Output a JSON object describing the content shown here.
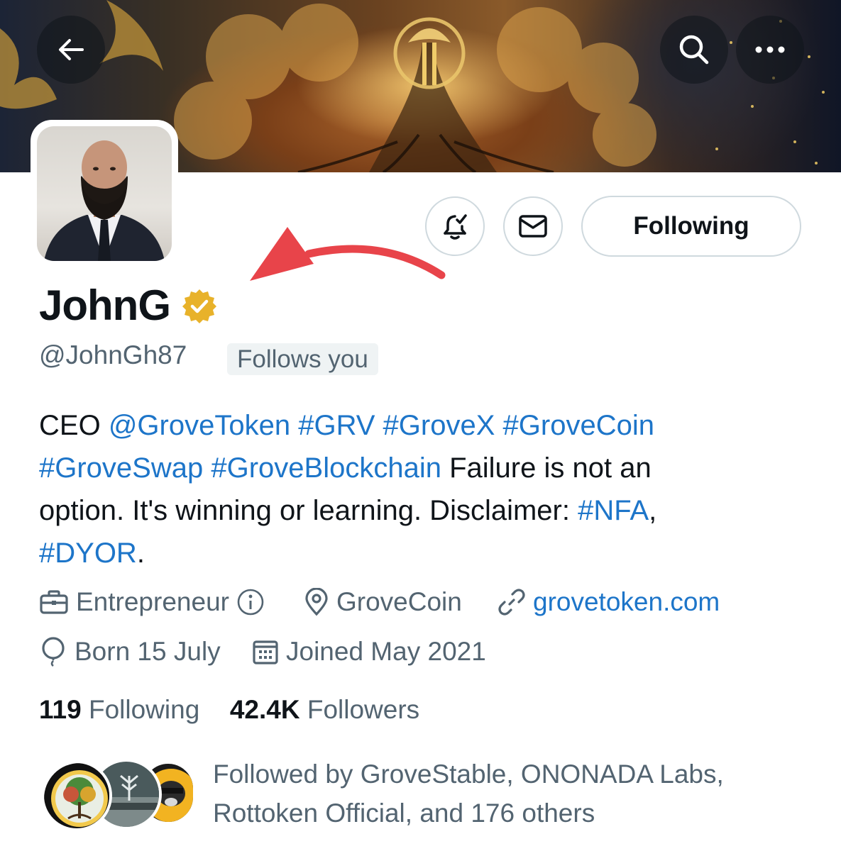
{
  "header": {
    "back_icon": "arrow-left-icon",
    "search_icon": "search-icon",
    "more_icon": "more-icon"
  },
  "actions": {
    "notify_icon": "bell-check-icon",
    "message_icon": "envelope-icon",
    "following_label": "Following"
  },
  "profile": {
    "display_name": "JohnG",
    "handle": "@JohnGh87",
    "follows_you": "Follows you",
    "verified_color": "#e8b22a"
  },
  "bio": {
    "l1_text": "CEO",
    "l1_mention": "@GroveToken",
    "l1_tag1": "#GRV",
    "l1_tag2": "#GroveX",
    "l1_tag3": "#GroveCoin",
    "l2_tag1": "#GroveSwap",
    "l2_tag2": "#GroveBlockchain",
    "l2_text": "Failure is not an",
    "l3_text": "option. It's winning or learning. Disclaimer:",
    "l3_tag": "#NFA",
    "l3_comma": ",",
    "l4_tag": "#DYOR",
    "l4_period": "."
  },
  "meta": {
    "category": "Entrepreneur",
    "location": "GroveCoin",
    "url": "grovetoken.com",
    "birthday": "Born 15 July",
    "joined": "Joined May 2021"
  },
  "counts": {
    "following_count": "119",
    "following_label": "Following",
    "followers_count": "42.4K",
    "followers_label": "Followers"
  },
  "followed_by": {
    "line1": "Followed by GroveStable, ONONADA Labs,",
    "line2": "Rottoken Official, and 176 others"
  },
  "colors": {
    "link": "#1d9bf0",
    "secondary_text": "#536471",
    "annotation_arrow": "#e8444a"
  }
}
